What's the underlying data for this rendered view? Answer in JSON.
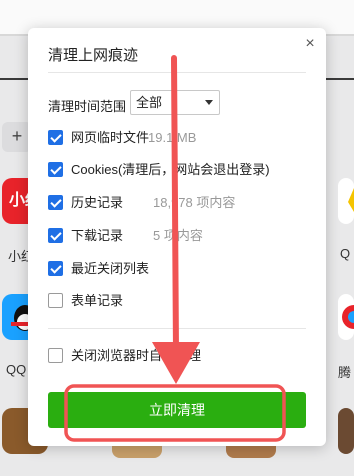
{
  "background": {
    "plus": "+",
    "tile_red_text": "小红",
    "labels": [
      "小红",
      "QQ",
      "Q",
      "腾"
    ]
  },
  "dialog": {
    "title": "清理上网痕迹",
    "close": "×",
    "range_label": "清理时间范围",
    "range_value": "全部",
    "options": [
      {
        "label": "网页临时文件",
        "meta": "19.1 MB",
        "checked": true
      },
      {
        "label": "Cookies(清理后，网站会退出登录)",
        "meta": "",
        "checked": true
      },
      {
        "label": "历史记录",
        "meta": "18,978 项内容",
        "checked": true
      },
      {
        "label": "下载记录",
        "meta": "5 项内容",
        "checked": true
      },
      {
        "label": "最近关闭列表",
        "meta": "",
        "checked": true
      },
      {
        "label": "表单记录",
        "meta": "",
        "checked": false
      }
    ],
    "auto_clear_label": "关闭浏览器时自动清理",
    "clean_button": "立即清理"
  },
  "colors": {
    "accent_blue": "#1f6fe5",
    "clean_green": "#2aae10",
    "annotation_red": "#f05454"
  }
}
